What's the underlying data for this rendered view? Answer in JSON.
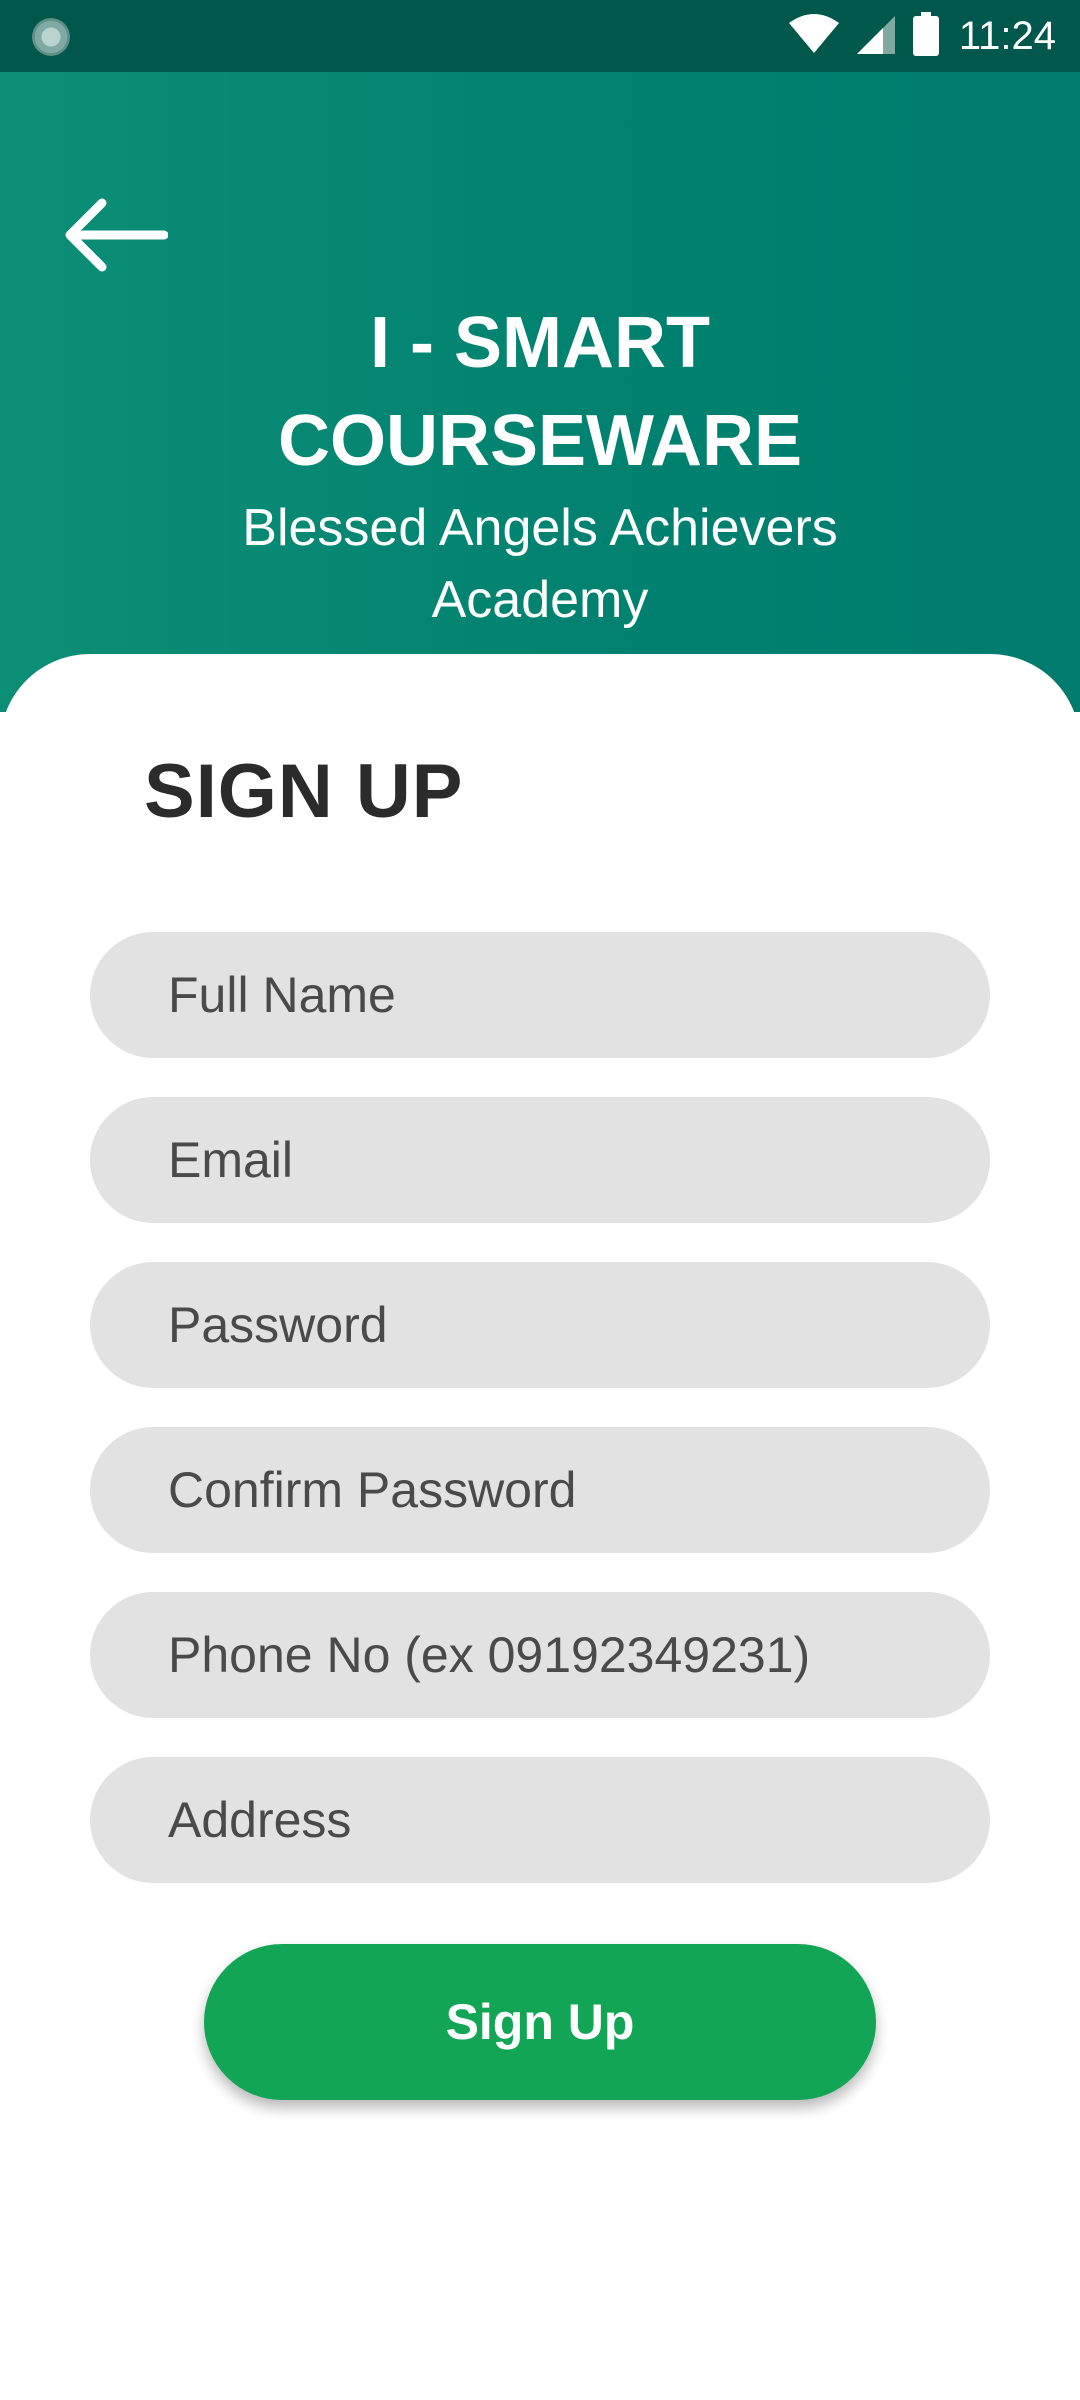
{
  "status_bar": {
    "time": "11:24",
    "left_icon": "app-notification-icon",
    "icons": [
      "wifi-icon",
      "cell-signal-icon",
      "battery-icon"
    ]
  },
  "header": {
    "back_icon": "arrow-left-icon",
    "title_line1": "I - SMART",
    "title_line2": "COURSEWARE",
    "subtitle_line1": "Blessed Angels Achievers",
    "subtitle_line2": "Academy"
  },
  "form": {
    "title": "SIGN UP",
    "fields": [
      {
        "placeholder": "Full Name"
      },
      {
        "placeholder": "Email"
      },
      {
        "placeholder": "Password"
      },
      {
        "placeholder": "Confirm Password"
      },
      {
        "placeholder": "Phone No (ex 09192349231)"
      },
      {
        "placeholder": "Address"
      }
    ],
    "submit_label": "Sign Up"
  },
  "colors": {
    "status_bar": "#00574b",
    "header": "#00816f",
    "field_bg": "#e2e2e2",
    "button": "#12a556"
  }
}
